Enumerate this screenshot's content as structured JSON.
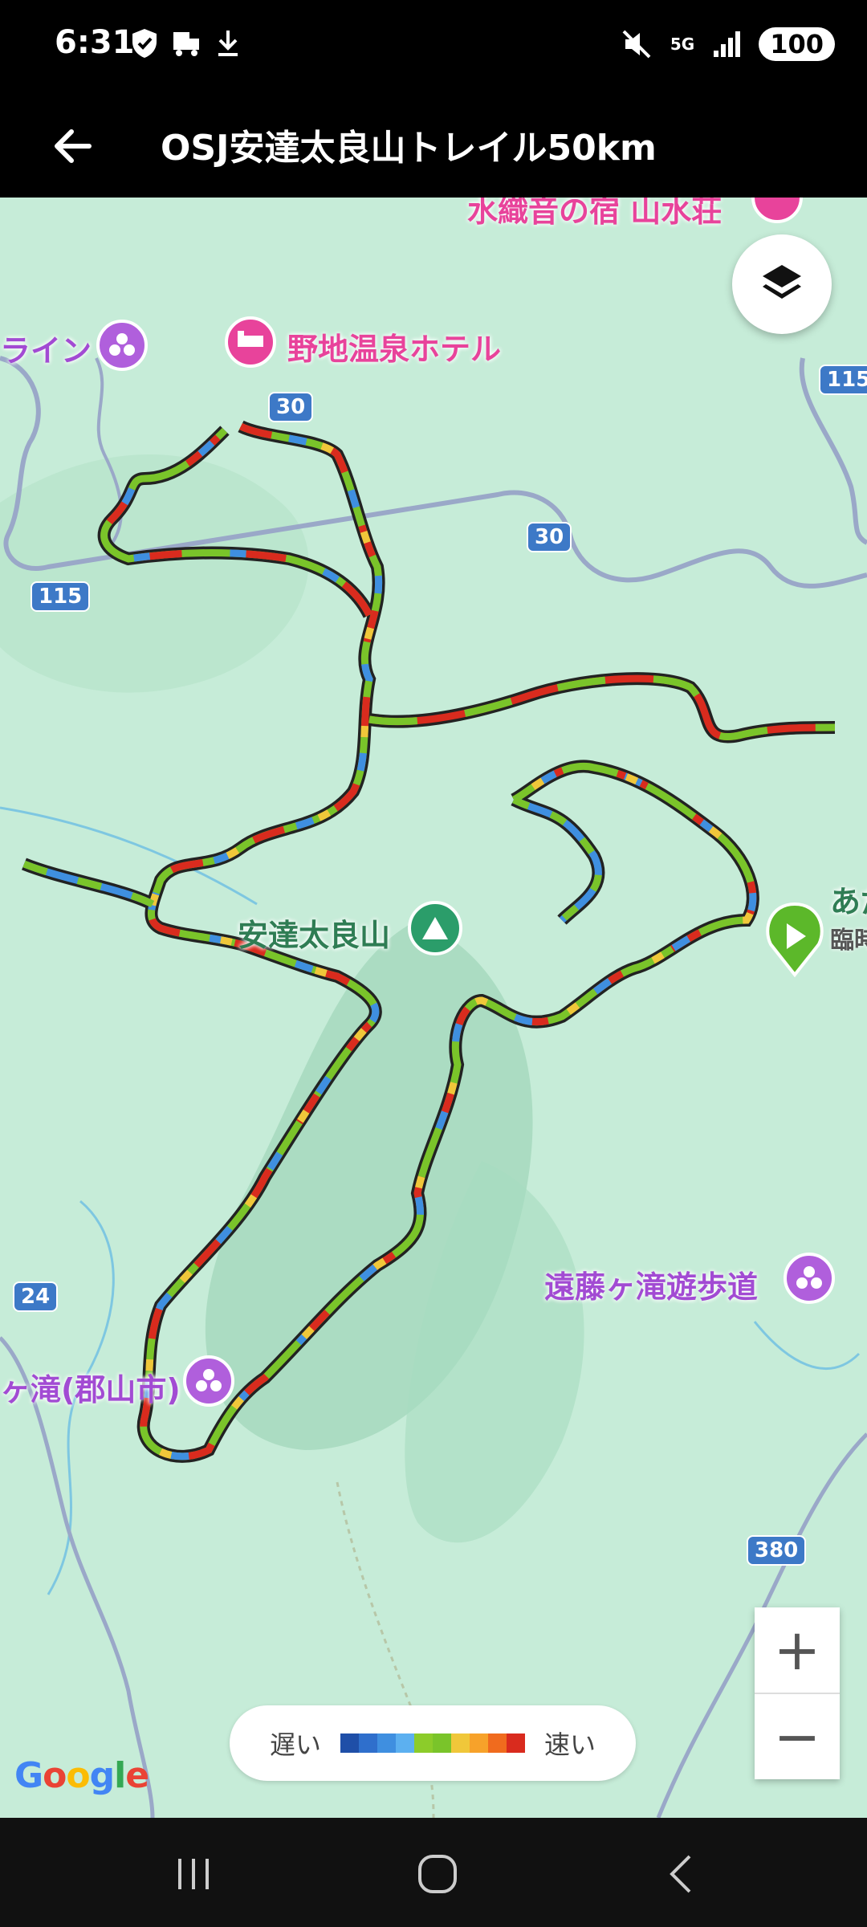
{
  "status_bar": {
    "time": "6:31",
    "battery": "100",
    "network": "5G"
  },
  "app_bar": {
    "title": "OSJ安達太良山トレイル50km"
  },
  "map": {
    "poi": {
      "top_label": "水織音の宿 山水荘",
      "left_top": "ライン",
      "onsen_hotel": "野地温泉ホテル",
      "adatara": "安達太良山",
      "start_label": "あだ",
      "start_sublabel": "臨時",
      "endo_falls": "遠藤ヶ滝遊歩道",
      "koriyama_falls": "ヶ滝(郡山市)"
    },
    "routes": [
      "30",
      "30",
      "115",
      "115",
      "24",
      "380"
    ]
  },
  "legend": {
    "slow": "遅い",
    "fast": "速い",
    "colors": [
      "#1f4fa8",
      "#2f6fcc",
      "#3f8fe0",
      "#5cb0f0",
      "#8ccc2a",
      "#7ac42a",
      "#f0c73a",
      "#f7a22a",
      "#f06b1e",
      "#d92b1e"
    ]
  },
  "zoom": {
    "in": "+",
    "out": "−"
  },
  "google": {
    "letters": [
      "G",
      "o",
      "o",
      "g",
      "l",
      "e"
    ],
    "colors": [
      "#4285F4",
      "#EA4335",
      "#FBBC05",
      "#4285F4",
      "#34A853",
      "#EA4335"
    ]
  }
}
